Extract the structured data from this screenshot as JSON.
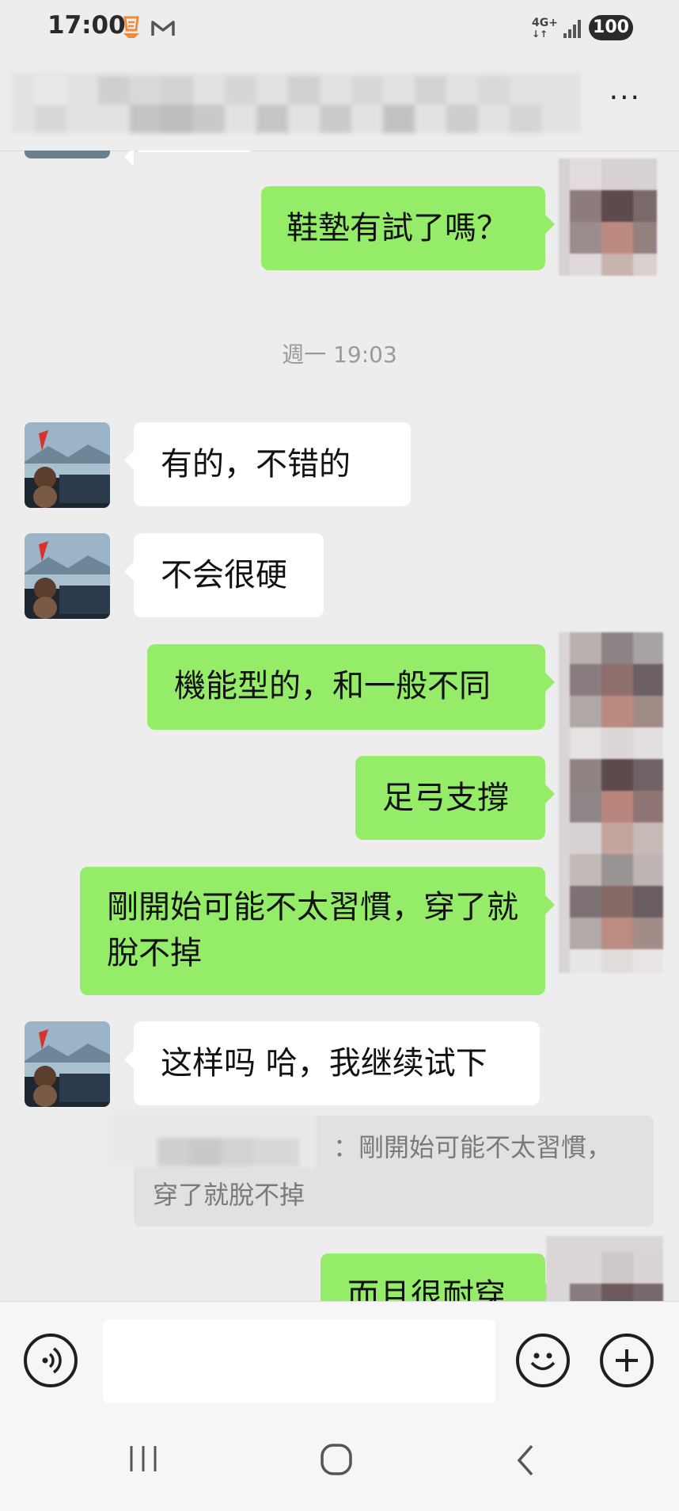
{
  "status_bar": {
    "time": "17:00",
    "network": "4G+",
    "battery": "100"
  },
  "header": {
    "title": "",
    "more_label": "···"
  },
  "messages": [
    {
      "side": "left",
      "text": ""
    },
    {
      "side": "right",
      "text": "鞋墊有試了嗎？"
    },
    {
      "type": "timestamp",
      "text": "週一 19:03"
    },
    {
      "side": "left",
      "text": "有的，不错的"
    },
    {
      "side": "left",
      "text": "不会很硬"
    },
    {
      "side": "right",
      "text": "機能型的，和一般不同"
    },
    {
      "side": "right",
      "text": "足弓支撐"
    },
    {
      "side": "right",
      "text": "剛開始可能不太習慣，穿了就脫不掉"
    },
    {
      "side": "left",
      "text": "这样吗 哈，我继续试下"
    },
    {
      "type": "quote",
      "sender": "",
      "text": "：剛開始可能不太習慣，穿了就脫不掉"
    },
    {
      "side": "right",
      "text": "而且很耐穿"
    }
  ],
  "input_bar": {
    "placeholder": ""
  },
  "icons": {
    "voice": "voice-icon",
    "emoji": "emoji-icon",
    "plus": "plus-icon",
    "recents": "recents-icon",
    "home": "home-icon",
    "back": "back-icon"
  },
  "colors": {
    "sent_bubble": "#95ec69",
    "received_bubble": "#ffffff",
    "background": "#ededed"
  }
}
